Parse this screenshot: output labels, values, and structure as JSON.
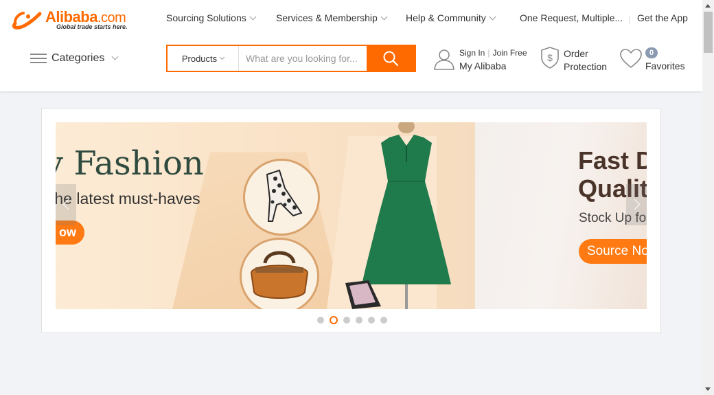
{
  "brand": {
    "name": "Alibaba",
    "suffix": ".com",
    "tagline": "Global trade starts here.",
    "accent_color": "#ff6a00"
  },
  "topnav": {
    "sourcing": "Sourcing Solutions",
    "services": "Services & Membership",
    "help": "Help & Community",
    "one_request": "One Request, Multiple...",
    "get_app": "Get the App"
  },
  "categories": {
    "label": "Categories"
  },
  "search": {
    "category": "Products",
    "placeholder": "What are you looking for...",
    "button_icon": "search-icon"
  },
  "account": {
    "sign_in": "Sign In",
    "join_free": "Join Free",
    "my_alibaba": "My Alibaba",
    "icon": "user-icon"
  },
  "order_protection": {
    "line1": "Order",
    "line2": "Protection",
    "icon": "shield-dollar-icon"
  },
  "favorites": {
    "count": "0",
    "label": "Favorites",
    "icon": "heart-icon"
  },
  "banner": {
    "slide_fashion": {
      "title": "y Fashion",
      "subtitle": "the latest must-haves",
      "button": "ow"
    },
    "slide_fast": {
      "title_line1": "Fast D",
      "title_line2": "Qualit",
      "subtitle": "Stock Up fo",
      "button": "Source No"
    },
    "dots_total": 6,
    "active_dot": 2
  }
}
